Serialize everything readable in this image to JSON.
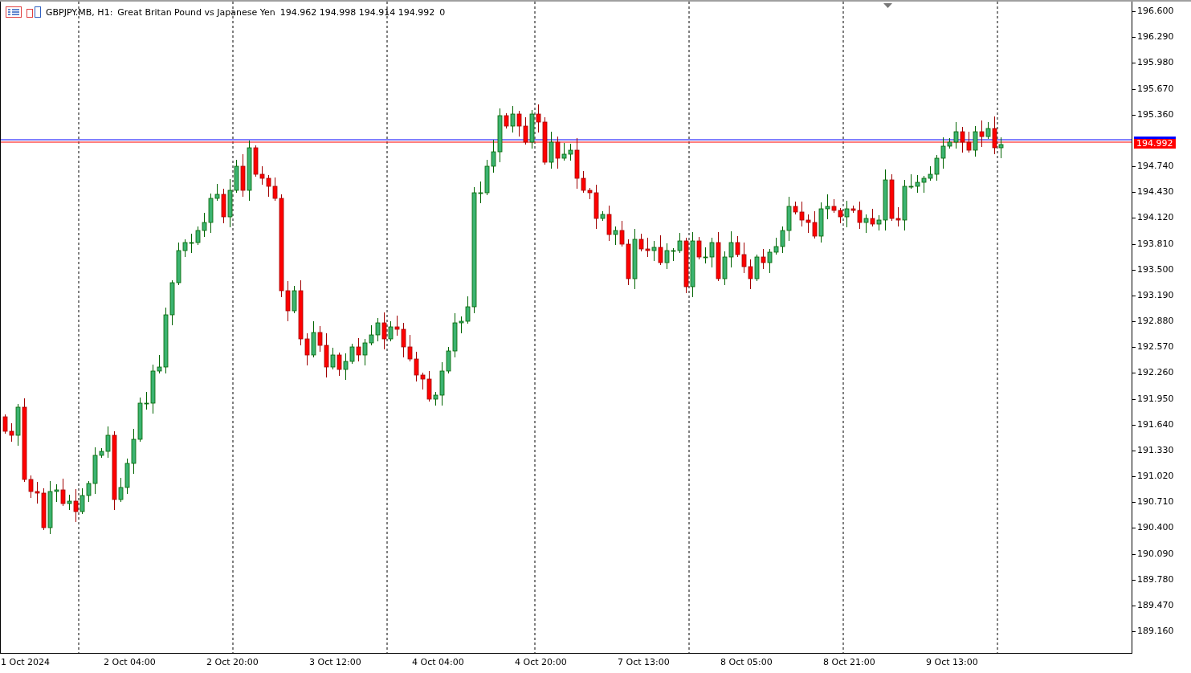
{
  "header": {
    "symbol": "GBPJPY.MB, H1:",
    "description": "Great Britan Pound vs Japanese Yen",
    "ohlc": "194.962 194.998 194.914 194.992",
    "volume": "0"
  },
  "price_axis_upper": [
    "196.600",
    "196.290",
    "195.980",
    "195.670",
    "195.360"
  ],
  "price_axis_lower": [
    "194.740",
    "194.430",
    "194.120",
    "193.810",
    "193.500",
    "193.190",
    "192.880",
    "192.570",
    "192.260",
    "191.950",
    "191.640",
    "191.330",
    "191.020",
    "190.710",
    "190.400",
    "190.090",
    "189.780",
    "189.470",
    "189.160"
  ],
  "price_tag": "194.992",
  "time_axis": [
    "1 Oct 2024",
    "2 Oct 04:00",
    "2 Oct 20:00",
    "3 Oct 12:00",
    "4 Oct 04:00",
    "4 Oct 20:00",
    "7 Oct 13:00",
    "8 Oct 05:00",
    "8 Oct 21:00",
    "9 Oct 13:00"
  ]
}
